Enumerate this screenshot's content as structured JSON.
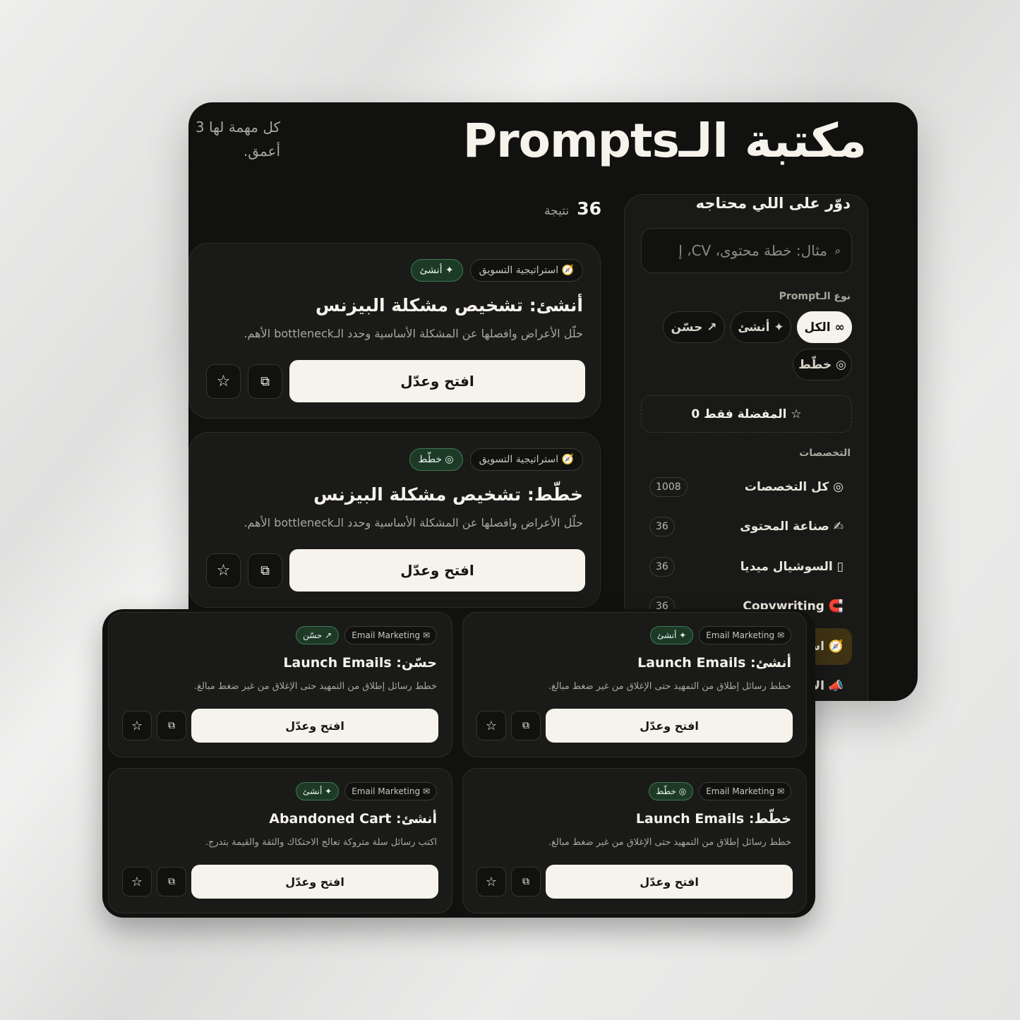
{
  "header": {
    "title": "مكتبة الـPrompts",
    "description": "كل مهمة لها 3 أعمق."
  },
  "sidebar": {
    "title": "دوّر على اللي محتاجه",
    "search": {
      "placeholder": "مثال: خطة محتوى، CV، إ",
      "icon": "⌕"
    },
    "type_label": "نوع الـPrompt",
    "type_filters": [
      {
        "label": "∞ الكل",
        "active": true
      },
      {
        "label": "✦ أنشئ",
        "active": false
      },
      {
        "label": "↗ حسّن",
        "active": false
      },
      {
        "label": "◎ خطّط",
        "active": false
      }
    ],
    "favorites_toggle": "☆ المفضلة فقط 0",
    "specialties_label": "التخصصات",
    "specialties": [
      {
        "label": "◎ كل التخصصات",
        "count": "1008",
        "active": false
      },
      {
        "label": "✍ صناعة المحتوى",
        "count": "36",
        "active": false
      },
      {
        "label": "▯ السوشيال ميديا",
        "count": "36",
        "active": false
      },
      {
        "label": "🧲 Copywriting",
        "count": "36",
        "active": false
      },
      {
        "label": "🧭 استراتيجية التسويق",
        "count": "",
        "active": true
      },
      {
        "label": "📣 الإعلانات",
        "count": "",
        "active": false
      }
    ]
  },
  "results": {
    "count": "36",
    "label": "نتيجة"
  },
  "cards": [
    {
      "category_tag": "🧭 استراتيجية التسويق",
      "type_tag": "✦ أنشئ",
      "title": "أنشئ: تشخيص مشكلة البيزنس",
      "description": "حلّل الأعراض وافصلها عن المشكلة الأساسية وحدد الـbottleneck الأهم.",
      "open_label": "افتح وعدّل",
      "copy_icon": "⧉",
      "star_icon": "☆"
    },
    {
      "category_tag": "🧭 استراتيجية التسويق",
      "type_tag": "◎ خطّط",
      "title": "خطّط: تشخيص مشكلة البيزنس",
      "description": "حلّل الأعراض وافصلها عن المشكلة الأساسية وحدد الـbottleneck الأهم.",
      "open_label": "افتح وعدّل",
      "copy_icon": "⧉",
      "star_icon": "☆"
    }
  ],
  "overlay_cards": [
    {
      "category_tag": "✉ Email Marketing",
      "type_tag": "✦ أنشئ",
      "title": "أنشئ: Launch Emails",
      "description": "خطط رسائل إطلاق من التمهيد حتى الإغلاق من غير ضغط مبالغ.",
      "open_label": "افتح وعدّل",
      "copy_icon": "⧉",
      "star_icon": "☆"
    },
    {
      "category_tag": "✉ Email Marketing",
      "type_tag": "↗ حسّن",
      "title": "حسّن: Launch Emails",
      "description": "خطط رسائل إطلاق من التمهيد حتى الإغلاق من غير ضغط مبالغ.",
      "open_label": "افتح وعدّل",
      "copy_icon": "⧉",
      "star_icon": "☆"
    },
    {
      "category_tag": "✉ Email Marketing",
      "type_tag": "◎ خطّط",
      "title": "خطّط: Launch Emails",
      "description": "خطط رسائل إطلاق من التمهيد حتى الإغلاق من غير ضغط مبالغ.",
      "open_label": "افتح وعدّل",
      "copy_icon": "⧉",
      "star_icon": "☆"
    },
    {
      "category_tag": "✉ Email Marketing",
      "type_tag": "✦ أنشئ",
      "title": "أنشئ: Abandoned Cart",
      "description": "اكتب رسائل سلة متروكة تعالج الاحتكاك والثقة والقيمة بتدرج.",
      "open_label": "افتح وعدّل",
      "copy_icon": "⧉",
      "star_icon": "☆"
    }
  ],
  "colors": {
    "background": "#111210",
    "card": "#1a1b19",
    "accent_cream": "#f6f3ec",
    "type_tag_green": "#1d3a27",
    "active_specialty": "#3f3314"
  }
}
